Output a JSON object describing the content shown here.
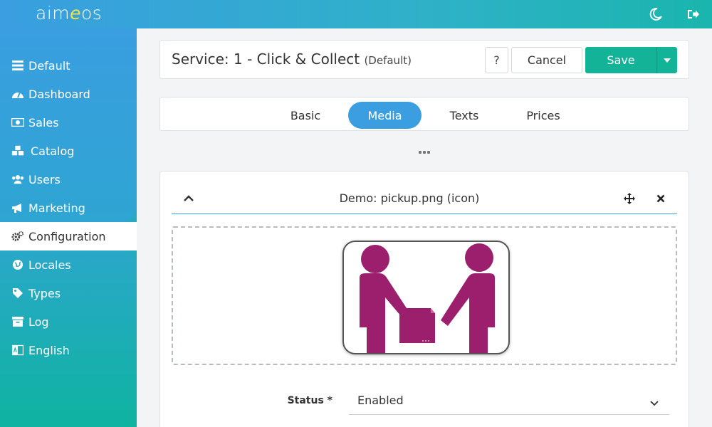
{
  "app": {
    "logo_text_a": "aim",
    "logo_text_e": "e",
    "logo_text_b": "os",
    "brand_color": "#3a9ee0",
    "accent_color": "#12b396"
  },
  "topbar": {
    "theme_icon": "moon-icon",
    "logout_icon": "logout-icon"
  },
  "sidebar": {
    "items": [
      {
        "label": "Default",
        "icon": "list-icon"
      },
      {
        "label": "Dashboard",
        "icon": "gauge-icon"
      },
      {
        "label": "Sales",
        "icon": "money-icon"
      },
      {
        "label": "Catalog",
        "icon": "cubes-icon"
      },
      {
        "label": "Users",
        "icon": "users-icon"
      },
      {
        "label": "Marketing",
        "icon": "megaphone-icon"
      },
      {
        "label": "Configuration",
        "icon": "cogs-icon",
        "active": true
      },
      {
        "label": "Locales",
        "icon": "globe-icon"
      },
      {
        "label": "Types",
        "icon": "tag-icon"
      },
      {
        "label": "Log",
        "icon": "archive-icon"
      },
      {
        "label": "English",
        "icon": "language-icon"
      }
    ]
  },
  "header": {
    "title": "Service: 1 - Click & Collect",
    "subtitle": "(Default)",
    "help_label": "?",
    "cancel_label": "Cancel",
    "save_label": "Save"
  },
  "tabs": [
    {
      "label": "Basic",
      "active": false
    },
    {
      "label": "Media",
      "active": true
    },
    {
      "label": "Texts",
      "active": false
    },
    {
      "label": "Prices",
      "active": false
    }
  ],
  "media_item": {
    "title": "Demo: pickup.png (icon)",
    "image_color": "#9c1f6e"
  },
  "form": {
    "status_label": "Status *",
    "status_value": "Enabled"
  }
}
